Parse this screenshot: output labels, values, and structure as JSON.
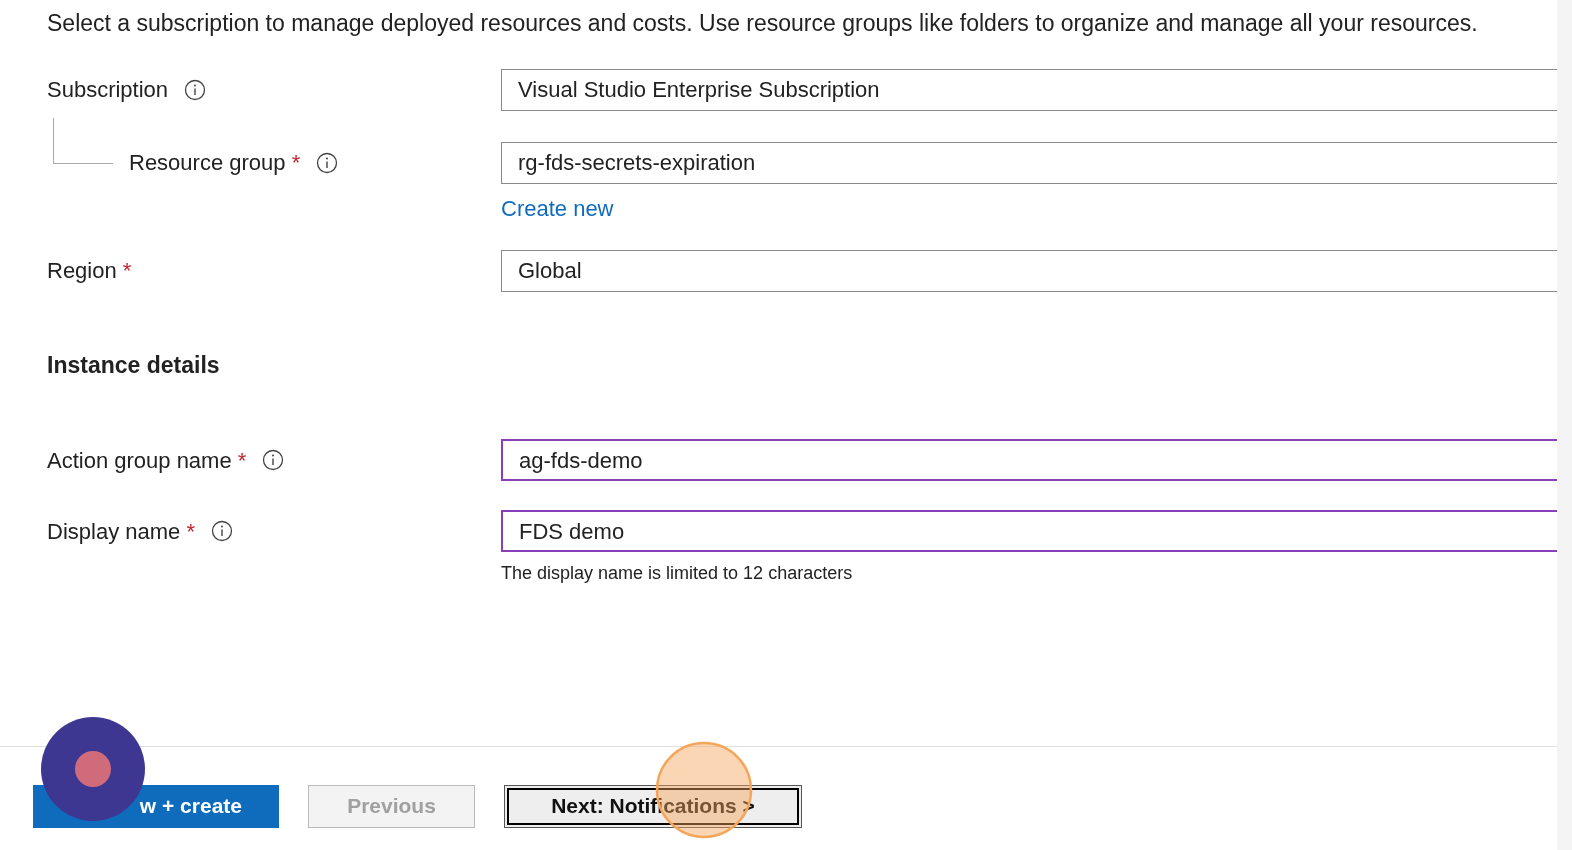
{
  "description": "Select a subscription to manage deployed resources and costs. Use resource groups like folders to organize and manage all your resources.",
  "project_fields": [
    {
      "label": "Subscription",
      "required": false,
      "info": true,
      "value": "Visual Studio Enterprise Subscription",
      "highlighted": false,
      "children": [
        {
          "label": "Resource group",
          "required": true,
          "info": true,
          "value": "rg-fds-secrets-expiration",
          "highlighted": false,
          "link": "Create new"
        }
      ]
    },
    {
      "label": "Region",
      "required": true,
      "info": false,
      "value": "Global",
      "highlighted": false
    }
  ],
  "instance_heading": "Instance details",
  "instance_fields": [
    {
      "label": "Action group name",
      "required": true,
      "info": true,
      "value": "ag-fds-demo",
      "highlighted": true
    },
    {
      "label": "Display name",
      "required": true,
      "info": true,
      "value": "FDS demo",
      "highlighted": true,
      "hint": "The display name is limited to 12 characters"
    }
  ],
  "required_mark": "*",
  "buttons": [
    {
      "kind": "primary",
      "label": "w + create",
      "disabled": false,
      "focused": false
    },
    {
      "kind": "secondary",
      "label": "Previous",
      "disabled": true,
      "focused": false
    },
    {
      "kind": "secondary",
      "label": "Next: Notifications >",
      "disabled": false,
      "focused": true
    }
  ]
}
